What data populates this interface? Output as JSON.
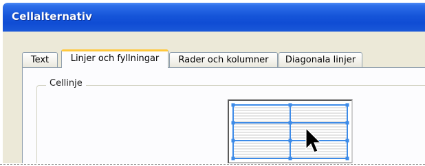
{
  "window": {
    "title": "Cellalternativ"
  },
  "tabs": [
    {
      "label": "Text",
      "active": false
    },
    {
      "label": "Linjer och fyllningar",
      "active": true
    },
    {
      "label": "Rader och kolumner",
      "active": false
    },
    {
      "label": "Diagonala linjer",
      "active": false
    }
  ],
  "group": {
    "label": "Cellinje"
  },
  "preview": {
    "grid_rows": 3,
    "grid_columns": 2,
    "line_color": "#3d8be8",
    "stripe_color": "#d4d4d4",
    "cursor_icon": "arrow-cursor-icon"
  },
  "colors": {
    "titlebar": "#0f4cd4",
    "active_tab_accent": "#ffc83c",
    "dialog_background": "#ece9d8"
  }
}
